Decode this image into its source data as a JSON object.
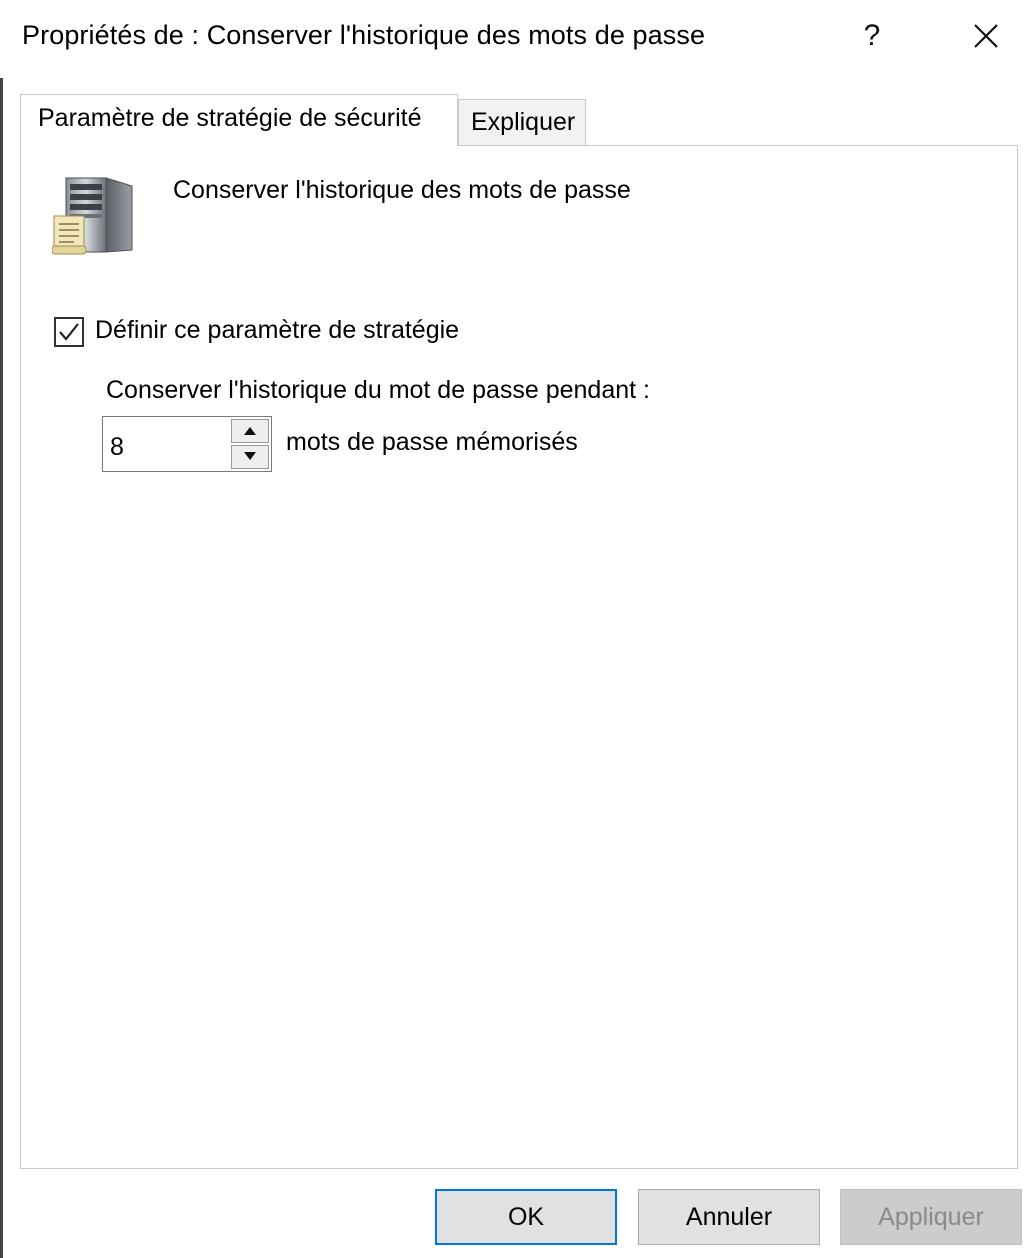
{
  "window": {
    "title": "Propriétés de : Conserver l'historique des mots de passe",
    "help_glyph": "?",
    "close_glyph": "✕"
  },
  "tabs": [
    {
      "label": "Paramètre de stratégie de sécurité",
      "active": true
    },
    {
      "label": "Expliquer",
      "active": false
    }
  ],
  "policy": {
    "name": "Conserver l'historique des mots de passe",
    "icon": "server-policy-icon",
    "define_checkbox": {
      "label": "Définir ce paramètre de stratégie",
      "checked": true
    },
    "retain_label": "Conserver l'historique du mot de passe pendant :",
    "spinner": {
      "value": "8",
      "unit_label": "mots de passe mémorisés"
    }
  },
  "buttons": {
    "ok": "OK",
    "cancel": "Annuler",
    "apply": "Appliquer",
    "apply_enabled": false
  },
  "colors": {
    "focus_border": "#0078d7",
    "button_face": "#e1e1e1",
    "disabled_text": "#8a8a8a",
    "panel_border": "#c9c9c9"
  }
}
